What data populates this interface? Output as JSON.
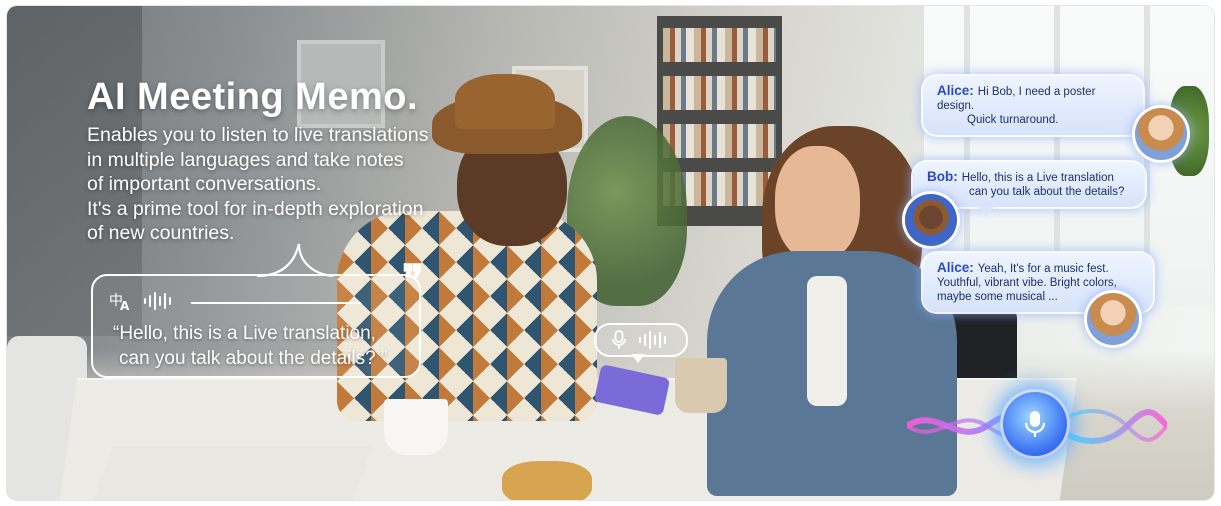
{
  "banner": {
    "headline": "AI Meeting Memo.",
    "description_lines": [
      "Enables you to listen to live translations",
      "in multiple languages and take notes",
      "of important conversations.",
      "It's a prime tool for in-depth exploration",
      "of new countries."
    ]
  },
  "translation_bubble": {
    "icons": [
      "translate-icon",
      "audio-wave-icon",
      "quote-icon"
    ],
    "line1": "“Hello, this is a Live translation,",
    "line2": "can you talk about the details? ”"
  },
  "mic_chip": {
    "icons": [
      "microphone-icon",
      "audio-wave-icon"
    ]
  },
  "chat": [
    {
      "speaker": "Alice:",
      "line1": "Hi Bob, I need a poster design.",
      "line2": "Quick turnaround."
    },
    {
      "speaker": "Bob:",
      "line1": "Hello, this is a Live translation",
      "line2": "can you talk about the details?"
    },
    {
      "speaker": "Alice:",
      "line1": "Yeah, It's for a music fest.",
      "line2": "Youthful, vibrant vibe. Bright colors,",
      "line3": "maybe some musical ..."
    }
  ],
  "voice_input": {
    "icon": "microphone-icon"
  },
  "colors": {
    "chat_name": "#2a4bc1",
    "chat_text": "#1b2f6b",
    "glow": "#8caaff",
    "wave_pink": "#ff5ad8",
    "wave_cyan": "#36e0ff"
  }
}
